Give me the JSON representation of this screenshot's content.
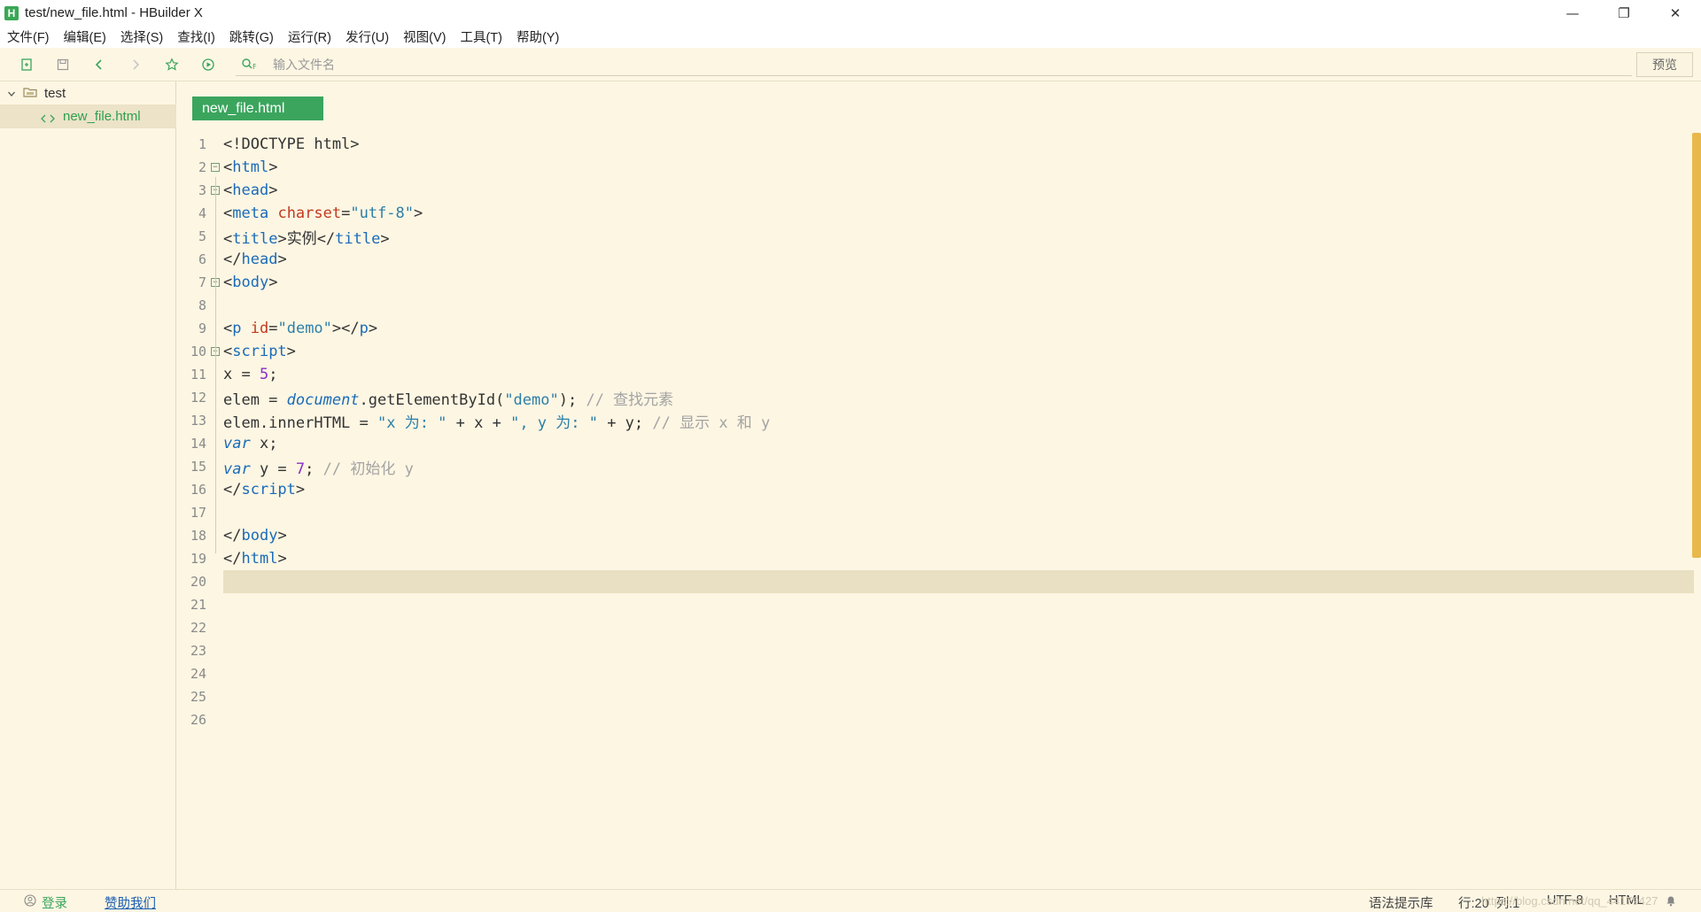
{
  "window": {
    "logo_letter": "H",
    "title": "test/new_file.html - HBuilder X",
    "minimize": "—",
    "maximize": "❐",
    "close": "✕"
  },
  "menu": [
    "文件(F)",
    "编辑(E)",
    "选择(S)",
    "查找(I)",
    "跳转(G)",
    "运行(R)",
    "发行(U)",
    "视图(V)",
    "工具(T)",
    "帮助(Y)"
  ],
  "toolbar": {
    "search_placeholder": "输入文件名",
    "search_icon_label": "Q F",
    "preview_label": "预览"
  },
  "sidebar": {
    "project": "test",
    "file": "new_file.html"
  },
  "editor": {
    "tab_label": "new_file.html",
    "current_line": 20,
    "line_numbers": [
      "1",
      "2",
      "3",
      "4",
      "5",
      "6",
      "7",
      "8",
      "9",
      "10",
      "11",
      "12",
      "13",
      "14",
      "15",
      "16",
      "17",
      "18",
      "19",
      "20",
      "21",
      "22",
      "23",
      "24",
      "25",
      "26"
    ],
    "code": {
      "l1": "<!DOCTYPE html>",
      "l2_open": "<",
      "l2_tag": "html",
      "l2_close": ">",
      "l3_open": "<",
      "l3_tag": "head",
      "l3_close": ">",
      "l4_open": "<",
      "l4_tag": "meta",
      "l4_sp": " ",
      "l4_attr": "charset",
      "l4_eq": "=",
      "l4_val": "\"utf-8\"",
      "l4_close": ">",
      "l5_open": "<",
      "l5_tag": "title",
      "l5_close": ">",
      "l5_text": "实例",
      "l5_end_open": "</",
      "l5_end_tag": "title",
      "l5_end_close": ">",
      "l6_open": "</",
      "l6_tag": "head",
      "l6_close": ">",
      "l7_open": "<",
      "l7_tag": "body",
      "l7_close": ">",
      "l9_open": "<",
      "l9_tag": "p",
      "l9_sp": " ",
      "l9_attr": "id",
      "l9_eq": "=",
      "l9_val": "\"demo\"",
      "l9_close": "></",
      "l9_end_tag": "p",
      "l9_end_close": ">",
      "l10_open": "<",
      "l10_tag": "script",
      "l10_close": ">",
      "l11_a": "x = ",
      "l11_num": "5",
      "l11_b": ";",
      "l12_a": "elem = ",
      "l12_obj": "document",
      "l12_b": ".getElementById(",
      "l12_str": "\"demo\"",
      "l12_c": "); ",
      "l12_comment": "// 查找元素",
      "l13_a": "elem.innerHTML = ",
      "l13_str1": "\"x 为: \"",
      "l13_b": " + x + ",
      "l13_str2": "\", y 为: \"",
      "l13_c": " + y; ",
      "l13_comment": "// 显示 x 和 y",
      "l14_kw": "var",
      "l14_a": " x;",
      "l15_kw": "var",
      "l15_a": " y = ",
      "l15_num": "7",
      "l15_b": "; ",
      "l15_comment": "// 初始化 y",
      "l16_open": "</",
      "l16_tag": "script",
      "l16_close": ">",
      "l18_open": "</",
      "l18_tag": "body",
      "l18_close": ">",
      "l19_open": "</",
      "l19_tag": "html",
      "l19_close": ">"
    }
  },
  "status": {
    "login": "登录",
    "sponsor": "赞助我们",
    "syntax_lib": "语法提示库",
    "position": "行:20  列:1",
    "encoding": "UTF-8",
    "language": "HTML",
    "watermark": "https://blog.csdn.net/qq_44179427"
  },
  "colors": {
    "accent_green": "#3ba55d",
    "background": "#fdf6e3",
    "scrollbar": "#e8b84a"
  }
}
